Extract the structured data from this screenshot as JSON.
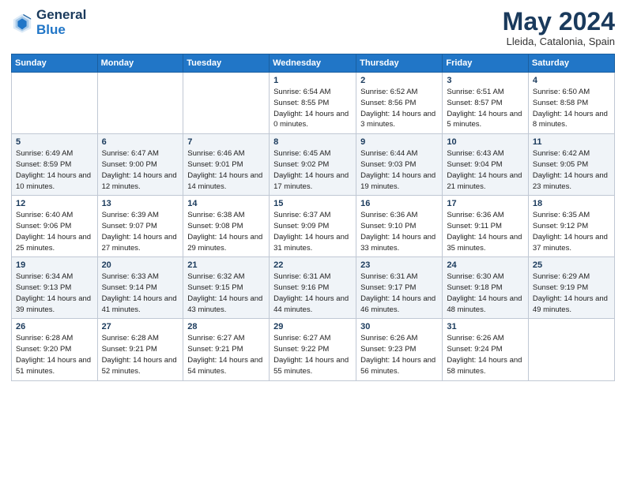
{
  "header": {
    "logo_general": "General",
    "logo_blue": "Blue",
    "month_title": "May 2024",
    "location": "Lleida, Catalonia, Spain"
  },
  "days_of_week": [
    "Sunday",
    "Monday",
    "Tuesday",
    "Wednesday",
    "Thursday",
    "Friday",
    "Saturday"
  ],
  "weeks": [
    [
      {
        "day": "",
        "sunrise": "",
        "sunset": "",
        "daylight": ""
      },
      {
        "day": "",
        "sunrise": "",
        "sunset": "",
        "daylight": ""
      },
      {
        "day": "",
        "sunrise": "",
        "sunset": "",
        "daylight": ""
      },
      {
        "day": "1",
        "sunrise": "Sunrise: 6:54 AM",
        "sunset": "Sunset: 8:55 PM",
        "daylight": "Daylight: 14 hours and 0 minutes."
      },
      {
        "day": "2",
        "sunrise": "Sunrise: 6:52 AM",
        "sunset": "Sunset: 8:56 PM",
        "daylight": "Daylight: 14 hours and 3 minutes."
      },
      {
        "day": "3",
        "sunrise": "Sunrise: 6:51 AM",
        "sunset": "Sunset: 8:57 PM",
        "daylight": "Daylight: 14 hours and 5 minutes."
      },
      {
        "day": "4",
        "sunrise": "Sunrise: 6:50 AM",
        "sunset": "Sunset: 8:58 PM",
        "daylight": "Daylight: 14 hours and 8 minutes."
      }
    ],
    [
      {
        "day": "5",
        "sunrise": "Sunrise: 6:49 AM",
        "sunset": "Sunset: 8:59 PM",
        "daylight": "Daylight: 14 hours and 10 minutes."
      },
      {
        "day": "6",
        "sunrise": "Sunrise: 6:47 AM",
        "sunset": "Sunset: 9:00 PM",
        "daylight": "Daylight: 14 hours and 12 minutes."
      },
      {
        "day": "7",
        "sunrise": "Sunrise: 6:46 AM",
        "sunset": "Sunset: 9:01 PM",
        "daylight": "Daylight: 14 hours and 14 minutes."
      },
      {
        "day": "8",
        "sunrise": "Sunrise: 6:45 AM",
        "sunset": "Sunset: 9:02 PM",
        "daylight": "Daylight: 14 hours and 17 minutes."
      },
      {
        "day": "9",
        "sunrise": "Sunrise: 6:44 AM",
        "sunset": "Sunset: 9:03 PM",
        "daylight": "Daylight: 14 hours and 19 minutes."
      },
      {
        "day": "10",
        "sunrise": "Sunrise: 6:43 AM",
        "sunset": "Sunset: 9:04 PM",
        "daylight": "Daylight: 14 hours and 21 minutes."
      },
      {
        "day": "11",
        "sunrise": "Sunrise: 6:42 AM",
        "sunset": "Sunset: 9:05 PM",
        "daylight": "Daylight: 14 hours and 23 minutes."
      }
    ],
    [
      {
        "day": "12",
        "sunrise": "Sunrise: 6:40 AM",
        "sunset": "Sunset: 9:06 PM",
        "daylight": "Daylight: 14 hours and 25 minutes."
      },
      {
        "day": "13",
        "sunrise": "Sunrise: 6:39 AM",
        "sunset": "Sunset: 9:07 PM",
        "daylight": "Daylight: 14 hours and 27 minutes."
      },
      {
        "day": "14",
        "sunrise": "Sunrise: 6:38 AM",
        "sunset": "Sunset: 9:08 PM",
        "daylight": "Daylight: 14 hours and 29 minutes."
      },
      {
        "day": "15",
        "sunrise": "Sunrise: 6:37 AM",
        "sunset": "Sunset: 9:09 PM",
        "daylight": "Daylight: 14 hours and 31 minutes."
      },
      {
        "day": "16",
        "sunrise": "Sunrise: 6:36 AM",
        "sunset": "Sunset: 9:10 PM",
        "daylight": "Daylight: 14 hours and 33 minutes."
      },
      {
        "day": "17",
        "sunrise": "Sunrise: 6:36 AM",
        "sunset": "Sunset: 9:11 PM",
        "daylight": "Daylight: 14 hours and 35 minutes."
      },
      {
        "day": "18",
        "sunrise": "Sunrise: 6:35 AM",
        "sunset": "Sunset: 9:12 PM",
        "daylight": "Daylight: 14 hours and 37 minutes."
      }
    ],
    [
      {
        "day": "19",
        "sunrise": "Sunrise: 6:34 AM",
        "sunset": "Sunset: 9:13 PM",
        "daylight": "Daylight: 14 hours and 39 minutes."
      },
      {
        "day": "20",
        "sunrise": "Sunrise: 6:33 AM",
        "sunset": "Sunset: 9:14 PM",
        "daylight": "Daylight: 14 hours and 41 minutes."
      },
      {
        "day": "21",
        "sunrise": "Sunrise: 6:32 AM",
        "sunset": "Sunset: 9:15 PM",
        "daylight": "Daylight: 14 hours and 43 minutes."
      },
      {
        "day": "22",
        "sunrise": "Sunrise: 6:31 AM",
        "sunset": "Sunset: 9:16 PM",
        "daylight": "Daylight: 14 hours and 44 minutes."
      },
      {
        "day": "23",
        "sunrise": "Sunrise: 6:31 AM",
        "sunset": "Sunset: 9:17 PM",
        "daylight": "Daylight: 14 hours and 46 minutes."
      },
      {
        "day": "24",
        "sunrise": "Sunrise: 6:30 AM",
        "sunset": "Sunset: 9:18 PM",
        "daylight": "Daylight: 14 hours and 48 minutes."
      },
      {
        "day": "25",
        "sunrise": "Sunrise: 6:29 AM",
        "sunset": "Sunset: 9:19 PM",
        "daylight": "Daylight: 14 hours and 49 minutes."
      }
    ],
    [
      {
        "day": "26",
        "sunrise": "Sunrise: 6:28 AM",
        "sunset": "Sunset: 9:20 PM",
        "daylight": "Daylight: 14 hours and 51 minutes."
      },
      {
        "day": "27",
        "sunrise": "Sunrise: 6:28 AM",
        "sunset": "Sunset: 9:21 PM",
        "daylight": "Daylight: 14 hours and 52 minutes."
      },
      {
        "day": "28",
        "sunrise": "Sunrise: 6:27 AM",
        "sunset": "Sunset: 9:21 PM",
        "daylight": "Daylight: 14 hours and 54 minutes."
      },
      {
        "day": "29",
        "sunrise": "Sunrise: 6:27 AM",
        "sunset": "Sunset: 9:22 PM",
        "daylight": "Daylight: 14 hours and 55 minutes."
      },
      {
        "day": "30",
        "sunrise": "Sunrise: 6:26 AM",
        "sunset": "Sunset: 9:23 PM",
        "daylight": "Daylight: 14 hours and 56 minutes."
      },
      {
        "day": "31",
        "sunrise": "Sunrise: 6:26 AM",
        "sunset": "Sunset: 9:24 PM",
        "daylight": "Daylight: 14 hours and 58 minutes."
      },
      {
        "day": "",
        "sunrise": "",
        "sunset": "",
        "daylight": ""
      }
    ]
  ]
}
